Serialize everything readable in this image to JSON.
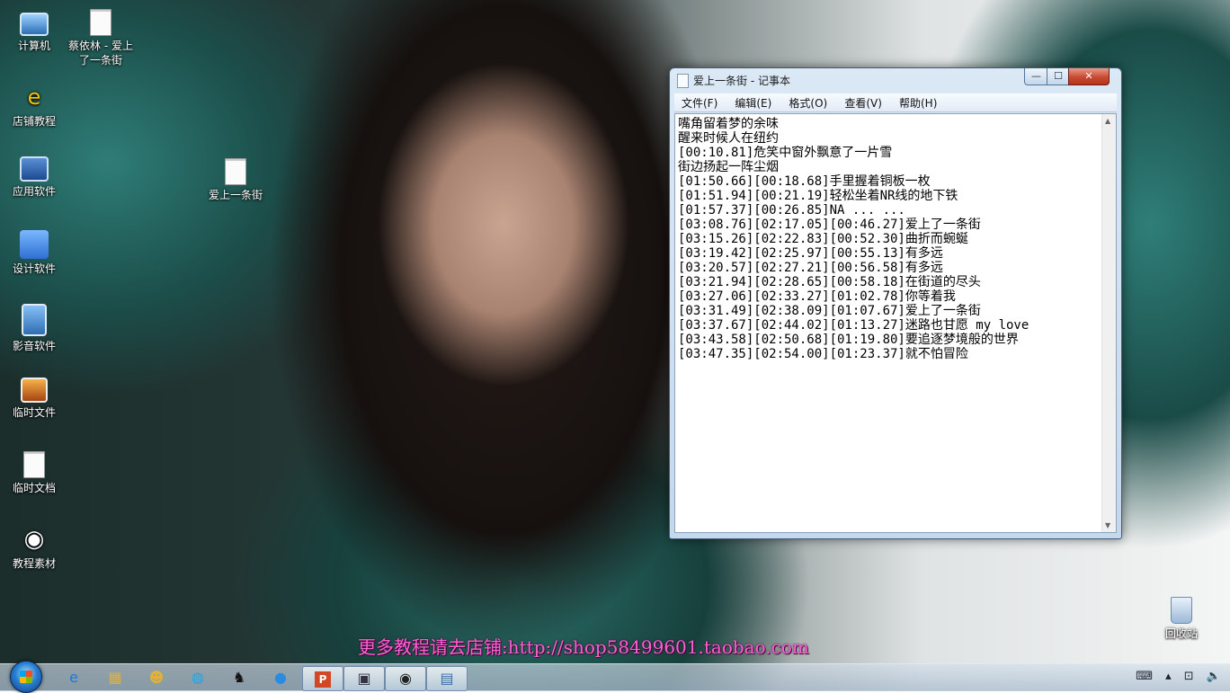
{
  "desktop": {
    "icons": [
      {
        "label": "计算机",
        "icon": "computer-icon"
      },
      {
        "label": "蔡依林 - 爱上了一条街",
        "icon": "document-icon"
      },
      {
        "label": "店铺教程",
        "icon": "ie-icon"
      },
      {
        "label": "应用软件",
        "icon": "software-folder-icon"
      },
      {
        "label": "爱上一条街",
        "icon": "document-icon"
      },
      {
        "label": "设计软件",
        "icon": "finder-icon"
      },
      {
        "label": "影音软件",
        "icon": "video-icon"
      },
      {
        "label": "临时文件",
        "icon": "photo-icon"
      },
      {
        "label": "临时文档",
        "icon": "document-icon"
      },
      {
        "label": "教程素材",
        "icon": "eye-icon"
      },
      {
        "label": "回收站",
        "icon": "recycle-bin-icon"
      }
    ],
    "wallpaper_caption": "更多教程请去店铺:http://shop58499601.taobao.com"
  },
  "notepad": {
    "title": "爱上一条街 - 记事本",
    "window_buttons": {
      "minimize": "—",
      "maximize": "☐",
      "close": "✕"
    },
    "menu": [
      "文件(F)",
      "编辑(E)",
      "格式(O)",
      "查看(V)",
      "帮助(H)"
    ],
    "lines": [
      "嘴角留着梦的余味",
      "醒来时候人在纽约",
      "[00:10.81]危笑中窗外飘意了一片雪",
      "街边扬起一阵尘烟",
      "[01:50.66][00:18.68]手里握着铜板一枚",
      "[01:51.94][00:21.19]轻松坐着NR线的地下铁",
      "[01:57.37][00:26.85]NA ... ...",
      "[03:08.76][02:17.05][00:46.27]爱上了一条街",
      "[03:15.26][02:22.83][00:52.30]曲折而蜿蜒",
      "[03:19.42][02:25.97][00:55.13]有多远",
      "[03:20.57][02:27.21][00:56.58]有多远",
      "[03:21.94][02:28.65][00:58.18]在街道的尽头",
      "[03:27.06][02:33.27][01:02.78]你等着我",
      "[03:31.49][02:38.09][01:07.67]爱上了一条街",
      "[03:37.67][02:44.02][01:13.27]迷路也甘愿 my love",
      "[03:43.58][02:50.68][01:19.80]要追逐梦境般的世界",
      "[03:47.35][02:54.00][01:23.37]就不怕冒险"
    ]
  },
  "taskbar": {
    "start_icon": "windows-start-icon",
    "apps": [
      {
        "name": "internet-explorer",
        "glyph": "e"
      },
      {
        "name": "file-explorer",
        "glyph": "▦"
      },
      {
        "name": "cat-app",
        "glyph": "☻"
      },
      {
        "name": "qq-browser",
        "glyph": "◍"
      },
      {
        "name": "qq",
        "glyph": "♞"
      },
      {
        "name": "chat-app",
        "glyph": "●"
      },
      {
        "name": "powerpoint",
        "glyph": "P"
      },
      {
        "name": "video-player",
        "glyph": "▣"
      },
      {
        "name": "viewer-app",
        "glyph": "◉"
      },
      {
        "name": "notepad",
        "glyph": "▤"
      }
    ],
    "tray": {
      "keyboard": "⌨",
      "arrow": "▴",
      "network": "⊡",
      "volume": "🔈"
    }
  }
}
